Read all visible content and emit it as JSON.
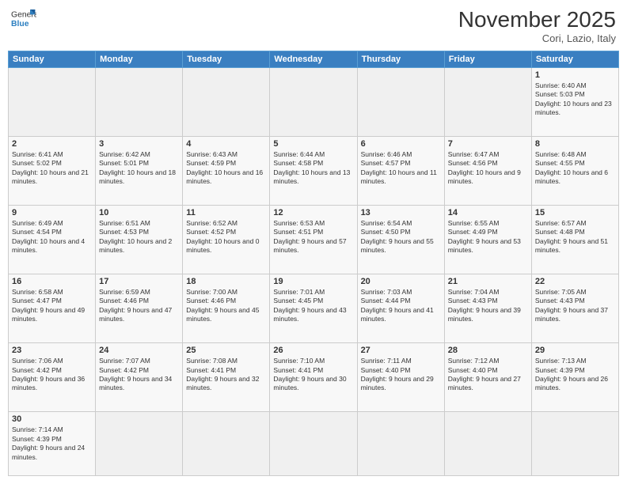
{
  "header": {
    "logo_general": "General",
    "logo_blue": "Blue",
    "month_year": "November 2025",
    "location": "Cori, Lazio, Italy"
  },
  "weekdays": [
    "Sunday",
    "Monday",
    "Tuesday",
    "Wednesday",
    "Thursday",
    "Friday",
    "Saturday"
  ],
  "weeks": [
    [
      {
        "day": "",
        "info": ""
      },
      {
        "day": "",
        "info": ""
      },
      {
        "day": "",
        "info": ""
      },
      {
        "day": "",
        "info": ""
      },
      {
        "day": "",
        "info": ""
      },
      {
        "day": "",
        "info": ""
      },
      {
        "day": "1",
        "info": "Sunrise: 6:40 AM\nSunset: 5:03 PM\nDaylight: 10 hours and 23 minutes."
      }
    ],
    [
      {
        "day": "2",
        "info": "Sunrise: 6:41 AM\nSunset: 5:02 PM\nDaylight: 10 hours and 21 minutes."
      },
      {
        "day": "3",
        "info": "Sunrise: 6:42 AM\nSunset: 5:01 PM\nDaylight: 10 hours and 18 minutes."
      },
      {
        "day": "4",
        "info": "Sunrise: 6:43 AM\nSunset: 4:59 PM\nDaylight: 10 hours and 16 minutes."
      },
      {
        "day": "5",
        "info": "Sunrise: 6:44 AM\nSunset: 4:58 PM\nDaylight: 10 hours and 13 minutes."
      },
      {
        "day": "6",
        "info": "Sunrise: 6:46 AM\nSunset: 4:57 PM\nDaylight: 10 hours and 11 minutes."
      },
      {
        "day": "7",
        "info": "Sunrise: 6:47 AM\nSunset: 4:56 PM\nDaylight: 10 hours and 9 minutes."
      },
      {
        "day": "8",
        "info": "Sunrise: 6:48 AM\nSunset: 4:55 PM\nDaylight: 10 hours and 6 minutes."
      }
    ],
    [
      {
        "day": "9",
        "info": "Sunrise: 6:49 AM\nSunset: 4:54 PM\nDaylight: 10 hours and 4 minutes."
      },
      {
        "day": "10",
        "info": "Sunrise: 6:51 AM\nSunset: 4:53 PM\nDaylight: 10 hours and 2 minutes."
      },
      {
        "day": "11",
        "info": "Sunrise: 6:52 AM\nSunset: 4:52 PM\nDaylight: 10 hours and 0 minutes."
      },
      {
        "day": "12",
        "info": "Sunrise: 6:53 AM\nSunset: 4:51 PM\nDaylight: 9 hours and 57 minutes."
      },
      {
        "day": "13",
        "info": "Sunrise: 6:54 AM\nSunset: 4:50 PM\nDaylight: 9 hours and 55 minutes."
      },
      {
        "day": "14",
        "info": "Sunrise: 6:55 AM\nSunset: 4:49 PM\nDaylight: 9 hours and 53 minutes."
      },
      {
        "day": "15",
        "info": "Sunrise: 6:57 AM\nSunset: 4:48 PM\nDaylight: 9 hours and 51 minutes."
      }
    ],
    [
      {
        "day": "16",
        "info": "Sunrise: 6:58 AM\nSunset: 4:47 PM\nDaylight: 9 hours and 49 minutes."
      },
      {
        "day": "17",
        "info": "Sunrise: 6:59 AM\nSunset: 4:46 PM\nDaylight: 9 hours and 47 minutes."
      },
      {
        "day": "18",
        "info": "Sunrise: 7:00 AM\nSunset: 4:46 PM\nDaylight: 9 hours and 45 minutes."
      },
      {
        "day": "19",
        "info": "Sunrise: 7:01 AM\nSunset: 4:45 PM\nDaylight: 9 hours and 43 minutes."
      },
      {
        "day": "20",
        "info": "Sunrise: 7:03 AM\nSunset: 4:44 PM\nDaylight: 9 hours and 41 minutes."
      },
      {
        "day": "21",
        "info": "Sunrise: 7:04 AM\nSunset: 4:43 PM\nDaylight: 9 hours and 39 minutes."
      },
      {
        "day": "22",
        "info": "Sunrise: 7:05 AM\nSunset: 4:43 PM\nDaylight: 9 hours and 37 minutes."
      }
    ],
    [
      {
        "day": "23",
        "info": "Sunrise: 7:06 AM\nSunset: 4:42 PM\nDaylight: 9 hours and 36 minutes."
      },
      {
        "day": "24",
        "info": "Sunrise: 7:07 AM\nSunset: 4:42 PM\nDaylight: 9 hours and 34 minutes."
      },
      {
        "day": "25",
        "info": "Sunrise: 7:08 AM\nSunset: 4:41 PM\nDaylight: 9 hours and 32 minutes."
      },
      {
        "day": "26",
        "info": "Sunrise: 7:10 AM\nSunset: 4:41 PM\nDaylight: 9 hours and 30 minutes."
      },
      {
        "day": "27",
        "info": "Sunrise: 7:11 AM\nSunset: 4:40 PM\nDaylight: 9 hours and 29 minutes."
      },
      {
        "day": "28",
        "info": "Sunrise: 7:12 AM\nSunset: 4:40 PM\nDaylight: 9 hours and 27 minutes."
      },
      {
        "day": "29",
        "info": "Sunrise: 7:13 AM\nSunset: 4:39 PM\nDaylight: 9 hours and 26 minutes."
      }
    ],
    [
      {
        "day": "30",
        "info": "Sunrise: 7:14 AM\nSunset: 4:39 PM\nDaylight: 9 hours and 24 minutes."
      },
      {
        "day": "",
        "info": ""
      },
      {
        "day": "",
        "info": ""
      },
      {
        "day": "",
        "info": ""
      },
      {
        "day": "",
        "info": ""
      },
      {
        "day": "",
        "info": ""
      },
      {
        "day": "",
        "info": ""
      }
    ]
  ]
}
